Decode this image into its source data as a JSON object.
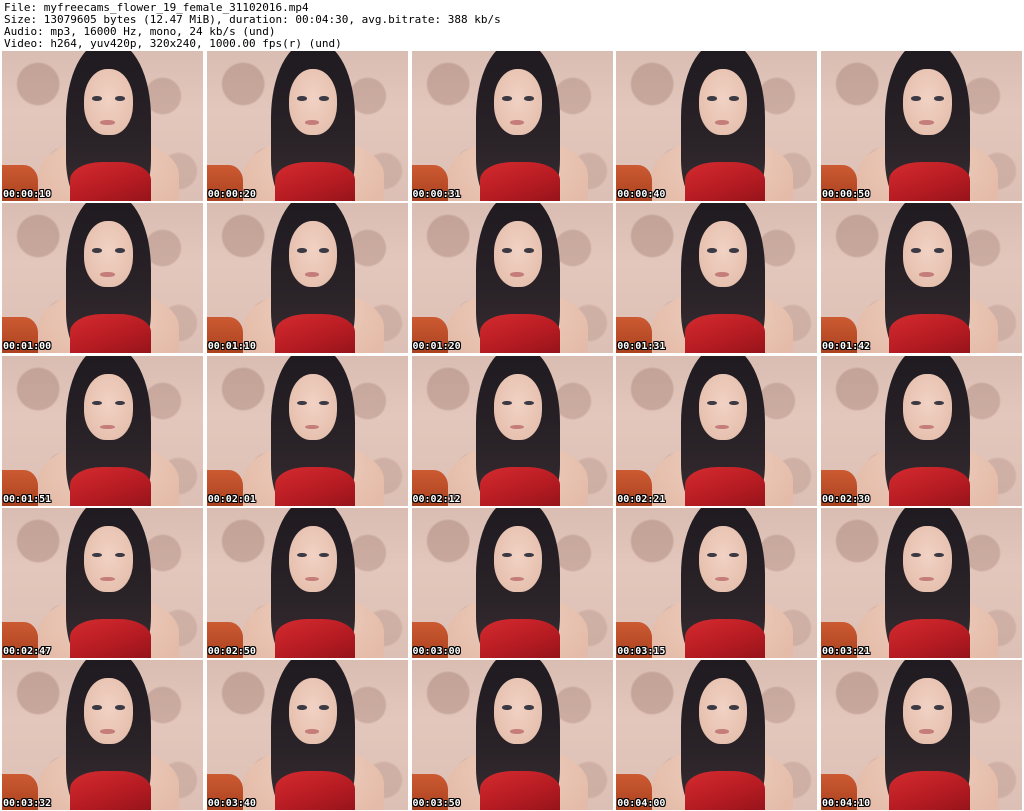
{
  "header": {
    "file_line": "File: myfreecams_flower_19_female_31102016.mp4",
    "size_line": "Size: 13079605 bytes (12.47 MiB), duration: 00:04:30, avg.bitrate: 388 kb/s",
    "audio_line": "Audio: mp3, 16000 Hz, mono, 24 kb/s (und)",
    "video_line": "Video: h264, yuv420p, 320x240, 1000.00 fps(r) (und)"
  },
  "thumbnails": [
    {
      "timestamp": "00:00:10"
    },
    {
      "timestamp": "00:00:20"
    },
    {
      "timestamp": "00:00:31"
    },
    {
      "timestamp": "00:00:40"
    },
    {
      "timestamp": "00:00:50"
    },
    {
      "timestamp": "00:01:00"
    },
    {
      "timestamp": "00:01:10"
    },
    {
      "timestamp": "00:01:20"
    },
    {
      "timestamp": "00:01:31"
    },
    {
      "timestamp": "00:01:42"
    },
    {
      "timestamp": "00:01:51"
    },
    {
      "timestamp": "00:02:01"
    },
    {
      "timestamp": "00:02:12"
    },
    {
      "timestamp": "00:02:21"
    },
    {
      "timestamp": "00:02:30"
    },
    {
      "timestamp": "00:02:47"
    },
    {
      "timestamp": "00:02:50"
    },
    {
      "timestamp": "00:03:00"
    },
    {
      "timestamp": "00:03:15"
    },
    {
      "timestamp": "00:03:21"
    },
    {
      "timestamp": "00:03:32"
    },
    {
      "timestamp": "00:03:40"
    },
    {
      "timestamp": "00:03:50"
    },
    {
      "timestamp": "00:04:00"
    },
    {
      "timestamp": "00:04:10"
    }
  ]
}
